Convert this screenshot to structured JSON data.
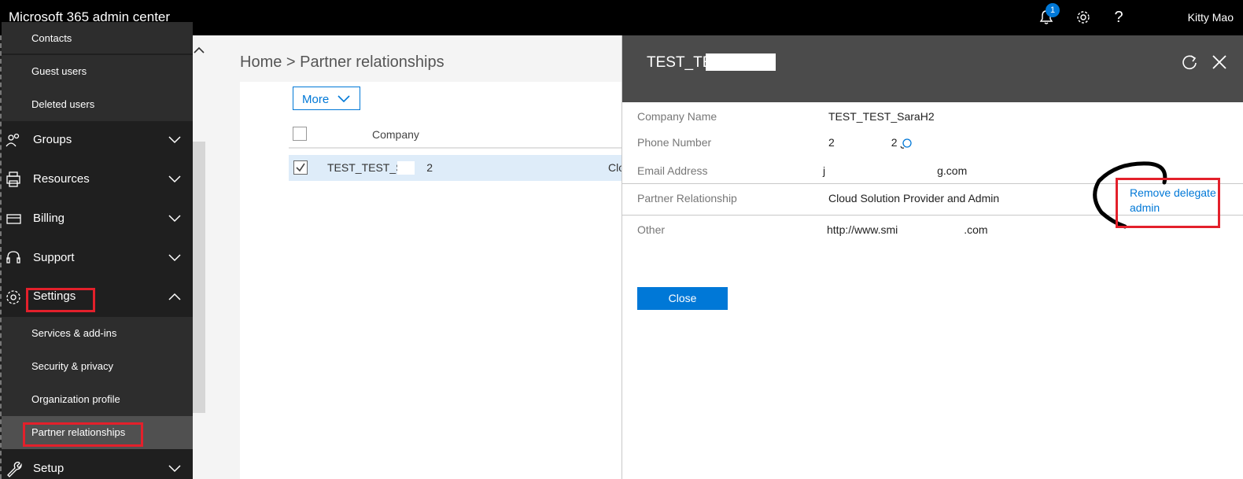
{
  "header": {
    "app_title": "Microsoft 365 admin center",
    "notification_count": "1",
    "help_label": "?",
    "user_name": "Kitty Mao"
  },
  "sidebar": {
    "users_sub": [
      "Contacts",
      "Guest users",
      "Deleted users"
    ],
    "groups": [
      "Groups",
      "Resources",
      "Billing",
      "Support",
      "Settings",
      "Setup"
    ],
    "settings_sub": [
      "Services & add-ins",
      "Security & privacy",
      "Organization profile",
      "Partner relationships"
    ],
    "active_item": "Partner relationships"
  },
  "main": {
    "breadcrumb": "Home > Partner relationships",
    "more_label": "More",
    "column_company": "Company",
    "row_company": "TEST_TEST_Sa",
    "row_company_suffix": "2",
    "row_type_partial": "Clo"
  },
  "panel": {
    "title": "TEST_TES",
    "fields": [
      {
        "label": "Company Name",
        "value": "TEST_TEST_SaraH2"
      },
      {
        "label": "Phone Number",
        "value": "2",
        "value_suffix": "2"
      },
      {
        "label": "Email Address",
        "value": "j",
        "value_suffix": "g.com"
      },
      {
        "label": "Partner Relationship",
        "value": "Cloud Solution Provider and Admin"
      },
      {
        "label": "Other",
        "value": "http://www.smi",
        "value_suffix": ".com"
      }
    ],
    "remove_link": "Remove delegate admin",
    "close_label": "Close"
  },
  "colors": {
    "accent": "#0078d7",
    "highlight": "#e3202b",
    "topbar": "#000000",
    "sidebar": "#1f1f1f",
    "panel_header": "#4b4b4b",
    "selected_row": "#deecf9"
  }
}
